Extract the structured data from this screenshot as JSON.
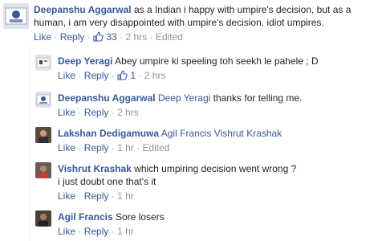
{
  "comments": [
    {
      "author": "Deepanshu Aggarwal",
      "text_line1": "as a Indian i happy with umpire's decision, but as a",
      "text_line2": "human, i am very disappointed with umpire's decision. idiot umpires.",
      "like": "Like",
      "reply": "Reply",
      "likes_count": "33",
      "time": "2 hrs",
      "edited": "Edited"
    },
    {
      "author": "Deep Yeragi",
      "text": "Abey umpire ki speeling toh seekh le pahele ; D",
      "like": "Like",
      "reply": "Reply",
      "likes_count": "1",
      "time": "2 hrs"
    },
    {
      "author": "Deepanshu Aggarwal",
      "tag": "Deep Yeragi",
      "text": "thanks for telling me.",
      "like": "Like",
      "reply": "Reply",
      "time": "2 hrs"
    },
    {
      "author": "Lakshan Dedigamuwa",
      "tags": "Agil Francis Vishrut Krashak",
      "like": "Like",
      "reply": "Reply",
      "time": "1 hr",
      "edited": "Edited"
    },
    {
      "author": "Vishrut Krashak",
      "text_line1": "which umpiring decision went wrong ?",
      "text_line2": "i just doubt one that's it",
      "like": "Like",
      "reply": "Reply",
      "time": "1 hr"
    },
    {
      "author": "Agil Francis",
      "text": "Sore losers",
      "like": "Like",
      "reply": "Reply",
      "time": "1 hr"
    }
  ],
  "separator": "·",
  "colors": {
    "link": "#365899",
    "meta": "#90949c",
    "text": "#1d2129"
  }
}
